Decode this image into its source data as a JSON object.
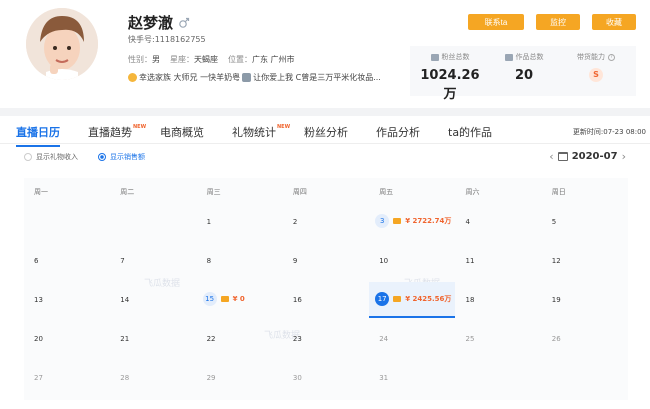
{
  "profile": {
    "name": "赵梦澈",
    "kuaishou_id": "快手号:1118162755",
    "gender_label": "性别：",
    "gender": "男",
    "zodiac_label": "星座：",
    "zodiac": "天蝎座",
    "location_label": "位置：",
    "location": "广东 广州市",
    "bio_parts": [
      "幸选家族 大师兄 一快羊奶粤",
      "让你爱上我 C曾是三万平米化妆品..."
    ]
  },
  "actions": {
    "contact_label": "联系ta",
    "monitor_label": "监控",
    "favorite_label": "收藏"
  },
  "stats": {
    "fans_label": "粉丝总数",
    "fans_value": "1024.26万",
    "works_label": "作品总数",
    "works_value": "20",
    "ability_label": "带货能力",
    "ability_value": "S"
  },
  "tabs": [
    {
      "label": "直播日历",
      "new": "",
      "active": true
    },
    {
      "label": "直播趋势",
      "new": "NEW",
      "active": false
    },
    {
      "label": "电商概览",
      "new": "",
      "active": false
    },
    {
      "label": "礼物统计",
      "new": "NEW",
      "active": false
    },
    {
      "label": "粉丝分析",
      "new": "",
      "active": false
    },
    {
      "label": "作品分析",
      "new": "",
      "active": false
    },
    {
      "label": "ta的作品",
      "new": "",
      "active": false
    }
  ],
  "update_time": "更新时间:07-23 08:00",
  "filters": {
    "gift_label": "显示礼物收入",
    "sales_label": "显示销售额"
  },
  "month": "2020-07",
  "weekdays": [
    "周一",
    "周二",
    "周三",
    "周四",
    "周五",
    "周六",
    "周日"
  ],
  "days": [
    {
      "d": "1",
      "col": 2,
      "row": 0
    },
    {
      "d": "2",
      "col": 3,
      "row": 0
    },
    {
      "d": "3",
      "col": 4,
      "row": 0,
      "amount": "¥ 2722.74万"
    },
    {
      "d": "4",
      "col": 5,
      "row": 0
    },
    {
      "d": "5",
      "col": 6,
      "row": 0
    },
    {
      "d": "6",
      "col": 0,
      "row": 1
    },
    {
      "d": "7",
      "col": 1,
      "row": 1
    },
    {
      "d": "8",
      "col": 2,
      "row": 1
    },
    {
      "d": "9",
      "col": 3,
      "row": 1
    },
    {
      "d": "10",
      "col": 4,
      "row": 1
    },
    {
      "d": "11",
      "col": 5,
      "row": 1
    },
    {
      "d": "12",
      "col": 6,
      "row": 1
    },
    {
      "d": "13",
      "col": 0,
      "row": 2
    },
    {
      "d": "14",
      "col": 1,
      "row": 2
    },
    {
      "d": "15",
      "col": 2,
      "row": 2,
      "amount": "¥ 0"
    },
    {
      "d": "16",
      "col": 3,
      "row": 2
    },
    {
      "d": "17",
      "col": 4,
      "row": 2,
      "amount": "¥ 2425.56万",
      "selected": true
    },
    {
      "d": "18",
      "col": 5,
      "row": 2
    },
    {
      "d": "19",
      "col": 6,
      "row": 2
    },
    {
      "d": "20",
      "col": 0,
      "row": 3
    },
    {
      "d": "21",
      "col": 1,
      "row": 3
    },
    {
      "d": "22",
      "col": 2,
      "row": 3
    },
    {
      "d": "23",
      "col": 3,
      "row": 3
    },
    {
      "d": "24",
      "col": 4,
      "row": 3,
      "dim": true
    },
    {
      "d": "25",
      "col": 5,
      "row": 3,
      "dim": true
    },
    {
      "d": "26",
      "col": 6,
      "row": 3,
      "dim": true
    },
    {
      "d": "27",
      "col": 0,
      "row": 4,
      "dim": true
    },
    {
      "d": "28",
      "col": 1,
      "row": 4,
      "dim": true
    },
    {
      "d": "29",
      "col": 2,
      "row": 4,
      "dim": true
    },
    {
      "d": "30",
      "col": 3,
      "row": 4,
      "dim": true
    },
    {
      "d": "31",
      "col": 4,
      "row": 4,
      "dim": true
    }
  ],
  "watermark": "飞瓜数据",
  "colors": {
    "accent": "#1a73e8",
    "button": "#f5a623",
    "amount": "#f0652f"
  }
}
